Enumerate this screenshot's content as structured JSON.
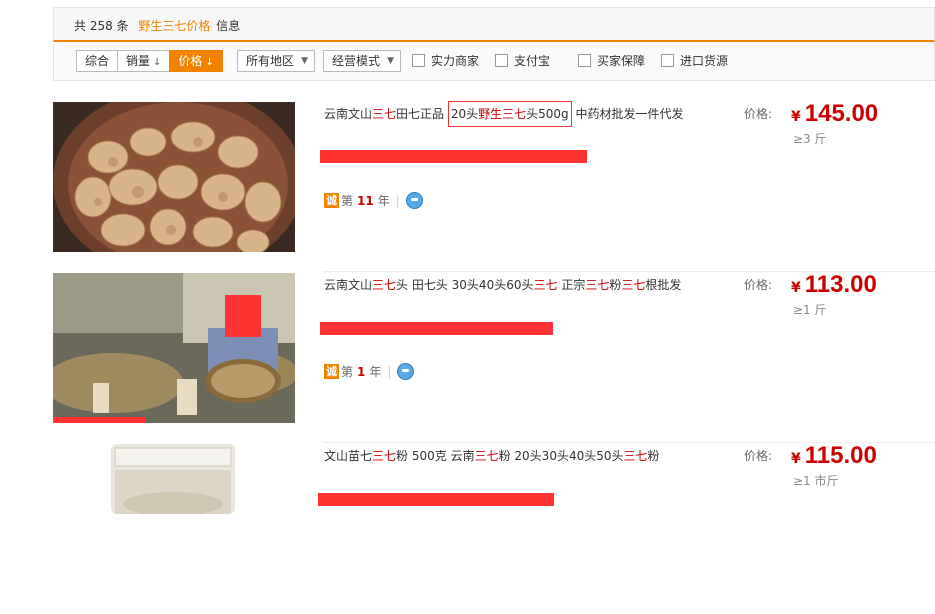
{
  "summary": {
    "prefix": "共 258 条",
    "keyword": "野生三七价格",
    "suffix": "信息"
  },
  "sort": {
    "items": [
      {
        "label": "综合",
        "arrow": ""
      },
      {
        "label": "销量",
        "arrow": "↓"
      },
      {
        "label": "价格",
        "arrow": "↓"
      }
    ]
  },
  "filters": {
    "region": "所有地区",
    "mode": "经营模式"
  },
  "checks": [
    "实力商家",
    "支付宝",
    "买家保障",
    "进口货源"
  ],
  "products": [
    {
      "title_parts": [
        "云南文山",
        "三七",
        "田七正品 ",
        "20头",
        "野生三七",
        "头500g",
        " 中药材批发一件代发"
      ],
      "cheng": "诚",
      "years_prefix": "第",
      "years": "11",
      "years_suffix": "年",
      "price_label": "价格:",
      "yen": "¥",
      "price": "145.00",
      "min_qty": "≥3 斤"
    },
    {
      "title_parts": [
        "云南文山",
        "三七",
        "头 田七头 30头40头60头",
        "三七",
        " 正宗",
        "三七",
        "粉",
        "三七",
        "根批发"
      ],
      "cheng": "诚",
      "years_prefix": "第",
      "years": "1",
      "years_suffix": "年",
      "price_label": "价格:",
      "yen": "¥",
      "price": "113.00",
      "min_qty": "≥1 斤"
    },
    {
      "title_parts": [
        "文山苗七",
        "三七",
        "粉 500克 云南",
        "三七",
        "粉 20头30头40头50头",
        "三七",
        "粉"
      ],
      "price_label": "价格:",
      "yen": "¥",
      "price": "115.00",
      "min_qty": "≥1 市斤"
    }
  ]
}
